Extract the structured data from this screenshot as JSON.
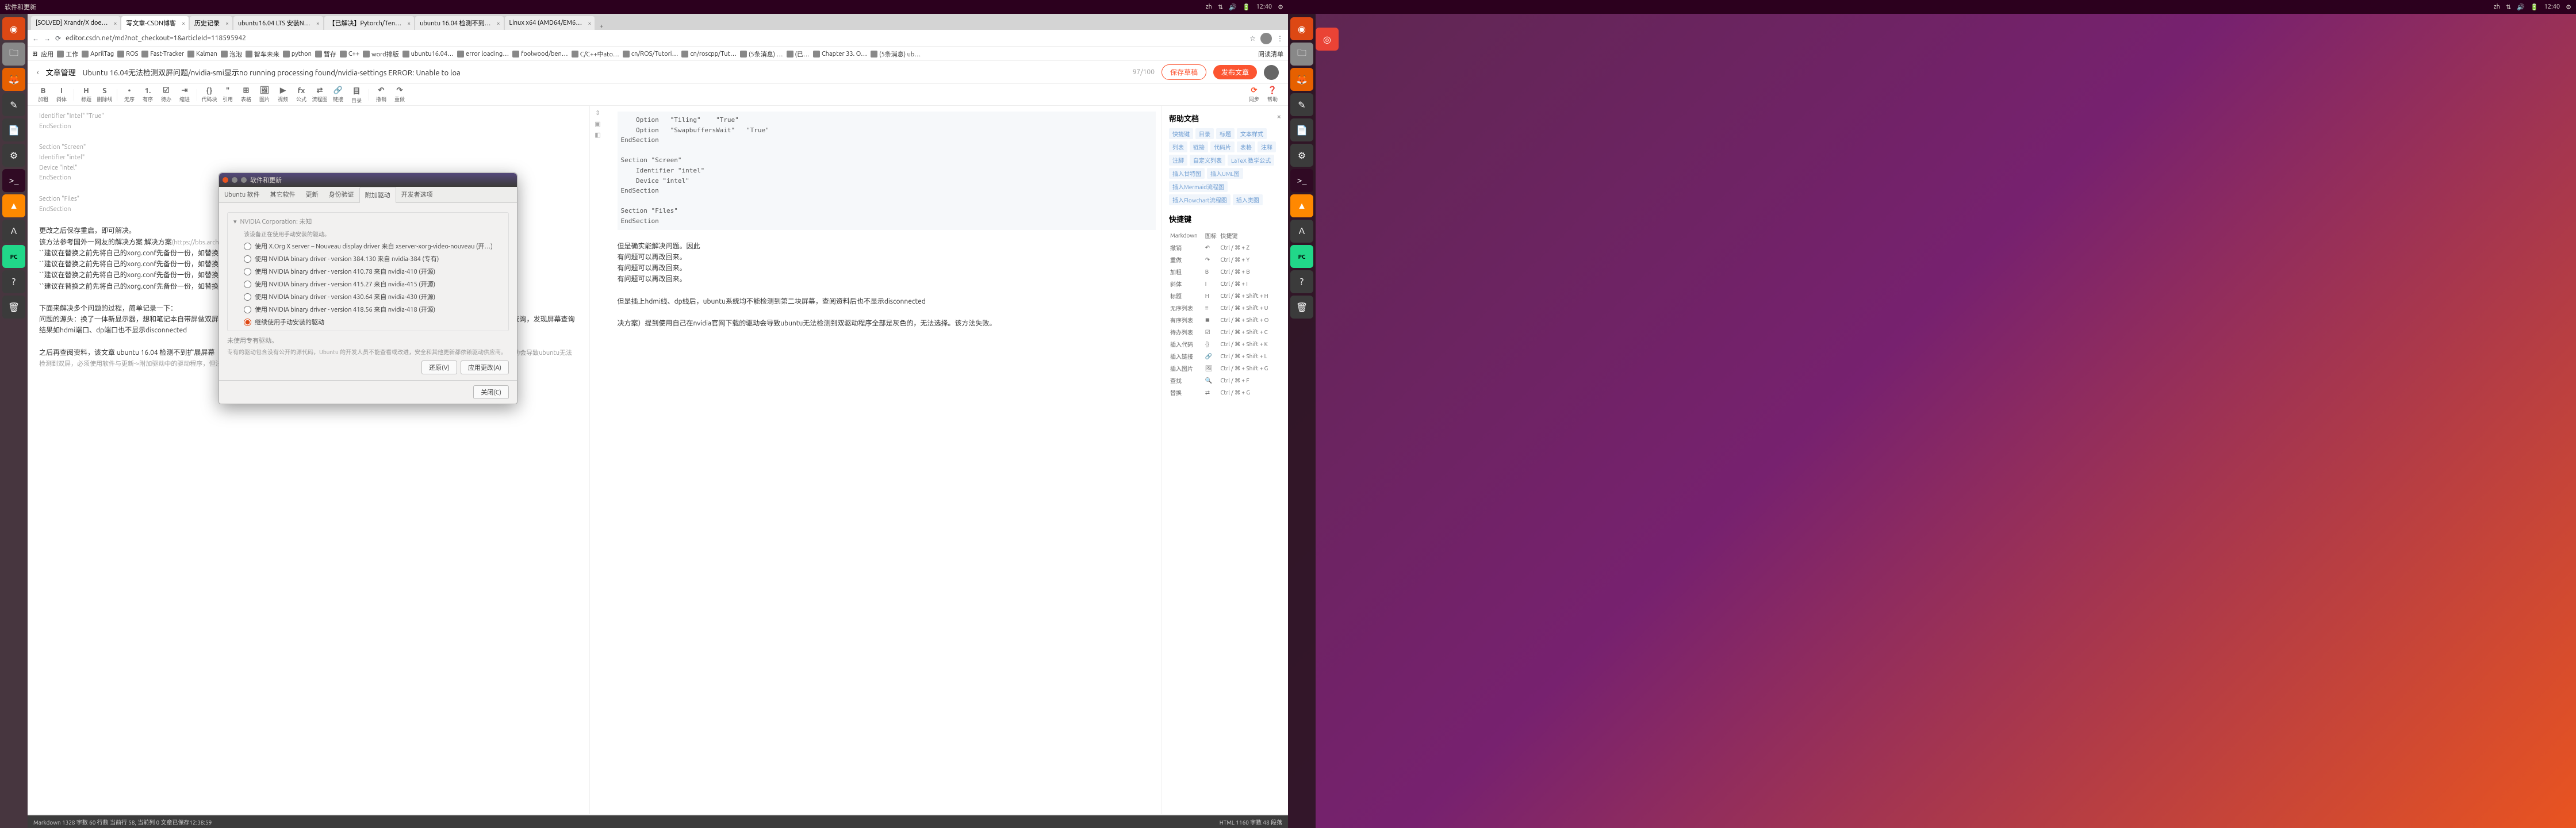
{
  "topbar": {
    "title": "软件和更新",
    "clock": "12:40",
    "lang": "zh"
  },
  "launcher": [
    {
      "name": "dash",
      "glyph": "◉"
    },
    {
      "name": "chrome",
      "glyph": "◎"
    },
    {
      "name": "files",
      "glyph": "🗀"
    },
    {
      "name": "firefox",
      "glyph": "🦊"
    },
    {
      "name": "gedit",
      "glyph": "✎"
    },
    {
      "name": "doc",
      "glyph": "📄"
    },
    {
      "name": "settings",
      "glyph": "⚙"
    },
    {
      "name": "term",
      "glyph": ">_"
    },
    {
      "name": "vlc",
      "glyph": "▲"
    },
    {
      "name": "store",
      "glyph": "A"
    },
    {
      "name": "pycharm",
      "glyph": "PC"
    },
    {
      "name": "help",
      "glyph": "?"
    },
    {
      "name": "trash",
      "glyph": "🗑"
    }
  ],
  "tabs": [
    {
      "label": "[SOLVED] Xrandr/X doe…",
      "active": false
    },
    {
      "label": "写文章-CSDN博客",
      "active": true
    },
    {
      "label": "历史记录",
      "active": false
    },
    {
      "label": "ubuntu16.04 LTS 安装N…",
      "active": false
    },
    {
      "label": "【已解决】Pytorch/Ten…",
      "active": false
    },
    {
      "label": "ubuntu 16.04 检测不到…",
      "active": false
    },
    {
      "label": "Linux x64 (AMD64/EM6…",
      "active": false
    }
  ],
  "url": "editor.csdn.net/md?not_checkout=1&articleId=118595942",
  "bookmarks": [
    {
      "label": "应用"
    },
    {
      "label": "工作"
    },
    {
      "label": "AprilTag"
    },
    {
      "label": "ROS"
    },
    {
      "label": "Fast-Tracker"
    },
    {
      "label": "Kalman"
    },
    {
      "label": "泡泡"
    },
    {
      "label": "智车未来"
    },
    {
      "label": "python"
    },
    {
      "label": "暂存"
    },
    {
      "label": "C++"
    },
    {
      "label": "word排版"
    },
    {
      "label": "ubuntu16.04…"
    },
    {
      "label": "error loading…"
    },
    {
      "label": "foolwood/ben…"
    },
    {
      "label": "C/C++中ato…"
    },
    {
      "label": "cn/ROS/Tutori…"
    },
    {
      "label": "cn/roscpp/Tut…"
    },
    {
      "label": "(5条消息) …"
    },
    {
      "label": "(已…"
    },
    {
      "label": "Chapter 33. O…"
    },
    {
      "label": "(5条消息) ub…"
    },
    {
      "label": "阅读清单"
    }
  ],
  "csdn": {
    "category": "文章管理",
    "title": "Ubuntu 16.04无法检测双屏问题/nvidia-smi显示no running processing found/nvidia-settings ERROR: Unable to loa",
    "count": "97/100",
    "draft": "保存草稿",
    "publish": "发布文章"
  },
  "toolbar": [
    {
      "i": "B",
      "l": "加粗"
    },
    {
      "i": "I",
      "l": "斜体"
    },
    {
      "i": "H",
      "l": "标题"
    },
    {
      "i": "S",
      "l": "删除线"
    },
    {
      "i": "•",
      "l": "无序"
    },
    {
      "i": "1.",
      "l": "有序"
    },
    {
      "i": "☑",
      "l": "待办"
    },
    {
      "i": "⇥",
      "l": "缩进"
    },
    {
      "i": "{}",
      "l": "代码块"
    },
    {
      "i": "\"",
      "l": "引用"
    },
    {
      "i": "⊞",
      "l": "表格"
    },
    {
      "i": "🖼",
      "l": "图片"
    },
    {
      "i": "▶",
      "l": "视频"
    },
    {
      "i": "fx",
      "l": "公式"
    },
    {
      "i": "⇄",
      "l": "流程图"
    },
    {
      "i": "🔗",
      "l": "链接"
    },
    {
      "i": "目",
      "l": "目录"
    },
    {
      "i": "↶",
      "l": "撤销"
    },
    {
      "i": "↷",
      "l": "重做"
    },
    {
      "i": "⟳",
      "l": "同步"
    },
    {
      "i": "❓",
      "l": "帮助"
    }
  ],
  "editor_left": {
    "l1": "    Identifier   \"Intel\"   \"True\"",
    "l2": "EndSection",
    "l3": "Section \"Screen\"",
    "l4": "    Identifier \"intel\"",
    "l5": "    Device \"intel\"",
    "l6": "EndSection",
    "l7": "Section \"Files\"",
    "l8": "EndSection",
    "p1": "更改之后保存重启，即可解决。",
    "p2": "该方法参考国外一网友的解决方案 解决方案",
    "p2b": "(https://bbs.archlinux.org/viewtopic.php?id=204800)。具体原理未知，但是操作有效。",
    "q1": "``建议在替换之前先将自己的xorg.conf先备份一份，如替换后有问题可以再改回来。``",
    "q2": "``建议在替换之前先将自己的xorg.conf先备份一份，如替换后有问题可以再改回来。``",
    "q3": "``建议在替换之前先将自己的xorg.conf先备份一份，如替换后有问题可以再改回来。``",
    "q4": "``建议在替换之前先将自己的xorg.conf先备份一份，如替换后有问题可以再改回来。``",
    "p3": "下面来解决多个问题的过程，简单记录一下：",
    "p4": "问题的源头：换了一体新显示器，想和笔记本自带屏做双屏，但是插上hdmi线、dp线后，ubuntu系统均不能检测到第二块屏幕，查阅资料后使用xrandr指令查询，发现屏幕查询结果如hdmi端口、dp端口也不显示disconnected",
    "p5": "之后再查阅资料，该文章 ubuntu 16.04 检测不到扩展屏幕（解决方案）",
    "p5b": "(https://blog.csdn.net/weixin_42007473/article/details) 提到使用自己在nvidia官网下载的驱动会导致ubuntu无法检测到双屏，必须使用软件与更新->附加驱动中的驱动程序，但注意如果按部就班全部更改，无法选择。该方法失败。"
  },
  "editor_right": {
    "code": "    Option   \"Tiling\"    \"True\"\n    Option   \"SwapbuffersWait\"   \"True\"\nEndSection\n\nSection \"Screen\"\n    Identifier \"intel\"\n    Device \"intel\"\nEndSection\n\nSection \"Files\"\nEndSection",
    "r1": "但是确实能解决问题。因此",
    "r2": "有问题可以再改回来。",
    "r3": "有问题可以再改回来。",
    "r4": "有问题可以再改回来。",
    "r5": "但是插上hdmi线、dp线后，ubuntu系统均不能检测到第二块屏幕，查阅资料后也不显示disconnected",
    "r6": "决方案）提到使用自己在nvidia官网下载的驱动会导致ubuntu无法检测到双驱动程序全部是灰色的，无法选择。该方法失败。"
  },
  "help": {
    "title": "帮助文档",
    "tags": [
      "快捷键",
      "目录",
      "标题",
      "文本样式",
      "列表",
      "链接",
      "代码片",
      "表格",
      "注释",
      "注脚",
      "自定义列表",
      "LaTeX 数学公式",
      "插入甘特图",
      "插入UML图",
      "插入Mermaid流程图",
      "插入Flowchart流程图",
      "插入类图"
    ],
    "shortcuts_title": "快捷键",
    "cols": [
      "Markdown",
      "图标",
      "快捷键"
    ],
    "rows": [
      [
        "撤销",
        "↶",
        "Ctrl / ⌘ + Z"
      ],
      [
        "重做",
        "↷",
        "Ctrl / ⌘ + Y"
      ],
      [
        "加粗",
        "B",
        "Ctrl / ⌘ + B"
      ],
      [
        "斜体",
        "I",
        "Ctrl / ⌘ + I"
      ],
      [
        "标题",
        "H",
        "Ctrl / ⌘ + Shift + H"
      ],
      [
        "无序列表",
        "≡",
        "Ctrl / ⌘ + Shift + U"
      ],
      [
        "有序列表",
        "≣",
        "Ctrl / ⌘ + Shift + O"
      ],
      [
        "待办列表",
        "☑",
        "Ctrl / ⌘ + Shift + C"
      ],
      [
        "插入代码",
        "{}",
        "Ctrl / ⌘ + Shift + K"
      ],
      [
        "插入链接",
        "🔗",
        "Ctrl / ⌘ + Shift + L"
      ],
      [
        "插入图片",
        "🖼",
        "Ctrl / ⌘ + Shift + G"
      ],
      [
        "查找",
        "🔍",
        "Ctrl / ⌘ + F"
      ],
      [
        "替换",
        "⇄",
        "Ctrl / ⌘ + G"
      ]
    ]
  },
  "status": {
    "l1": "Markdown  1328 字数  60 行数  当前行 58, 当前列 0  文章已保存12:38:59",
    "r1": "HTML  1160 字数  48 段落"
  },
  "dialog": {
    "title": "软件和更新",
    "tabs": [
      "Ubuntu 软件",
      "其它软件",
      "更新",
      "身份验证",
      "附加驱动",
      "开发者选项"
    ],
    "active_tab": 4,
    "vendor": "NVIDIA Corporation: 未知",
    "hint": "该设备正在使用手动安装的驱动。",
    "options": [
      "使用 X.Org X server – Nouveau display driver 来自 xserver-xorg-video-nouveau (开…)",
      "使用 NVIDIA binary driver - version 384.130 来自 nvidia-384 (专有)",
      "使用 NVIDIA binary driver - version 410.78 来自 nvidia-410 (开源)",
      "使用 NVIDIA binary driver - version 415.27 来自 nvidia-415 (开源)",
      "使用 NVIDIA binary driver - version 430.64 来自 nvidia-430 (开源)",
      "使用 NVIDIA binary driver - version 418.56 来自 nvidia-418 (开源)",
      "继续使用手动安装的驱动"
    ],
    "selected": 6,
    "note_title": "未使用专有驱动。",
    "note": "专有的驱动包含没有公开的源代码，Ubuntu 的开发人员不能查看或改进，安全和其他更新都依赖驱动供应商。",
    "btn_restore": "还原(V)",
    "btn_apply": "应用更改(A)",
    "btn_close": "关闭(C)"
  }
}
